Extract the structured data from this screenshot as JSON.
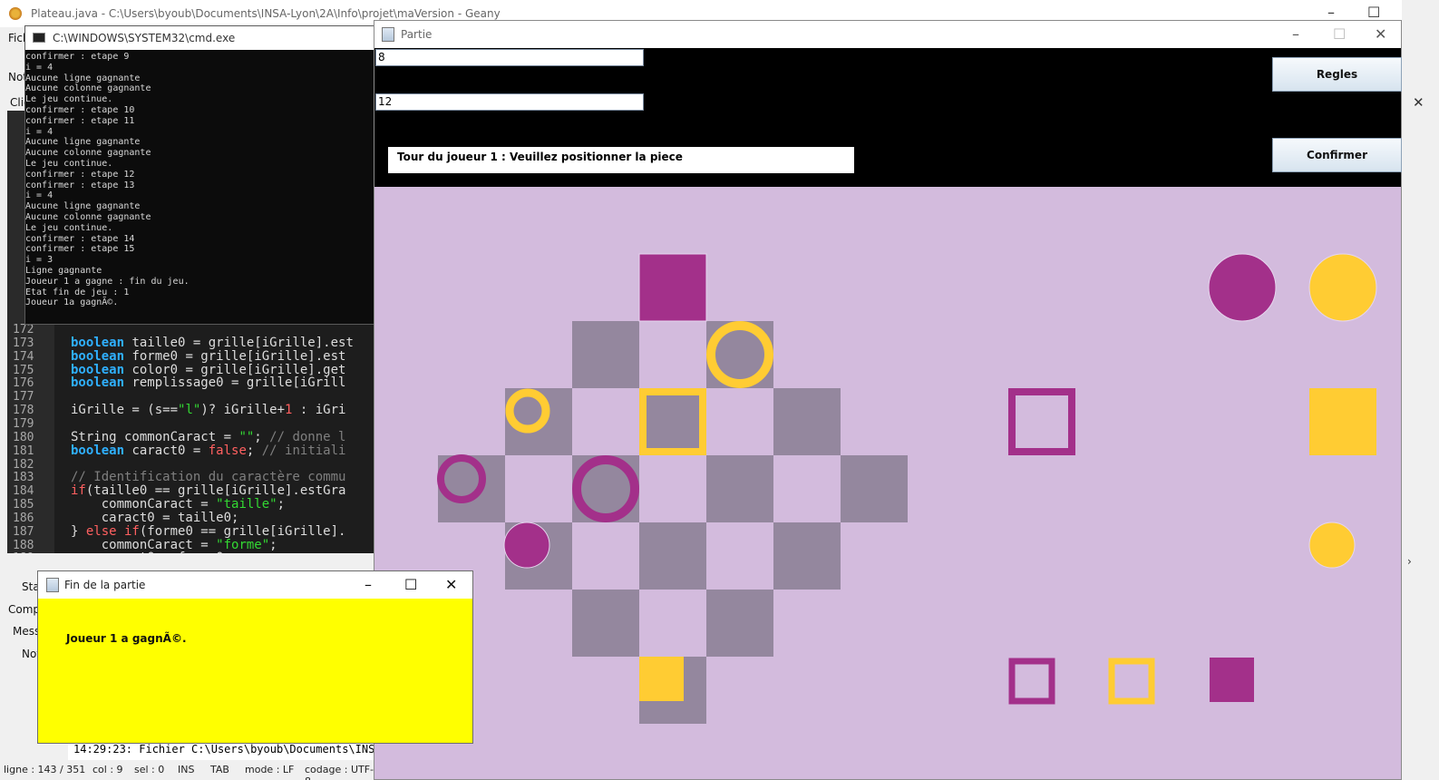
{
  "geany": {
    "title": "Plateau.java - C:\\Users\\byoub\\Documents\\INSA-Lyon\\2A\\Info\\projet\\maVersion - Geany",
    "menu_partial": "Fich",
    "toolbar_partial": "Not",
    "tab_partial": "Clic",
    "side_labels": [
      "Stat",
      "Compi",
      "Mess",
      "Not"
    ],
    "message_line": "14:29:23: Fichier C:\\Users\\byoub\\Documents\\INSA-",
    "status": {
      "line": "ligne : 143 / 351",
      "col": "col : 9",
      "sel": "sel : 0",
      "ins": "INS",
      "tab": "TAB",
      "mode": "mode : LF",
      "codage": "codage : UTF-8"
    },
    "code_lines": [
      {
        "n": "172",
        "parts": []
      },
      {
        "n": "173",
        "parts": [
          {
            "c": "kw",
            "t": "boolean"
          },
          {
            "c": "",
            "t": " taille0 = grille[iGrille].est"
          }
        ]
      },
      {
        "n": "174",
        "parts": [
          {
            "c": "kw",
            "t": "boolean"
          },
          {
            "c": "",
            "t": " forme0 = grille[iGrille].est"
          }
        ]
      },
      {
        "n": "175",
        "parts": [
          {
            "c": "kw",
            "t": "boolean"
          },
          {
            "c": "",
            "t": " color0 = grille[iGrille].get"
          }
        ]
      },
      {
        "n": "176",
        "parts": [
          {
            "c": "kw",
            "t": "boolean"
          },
          {
            "c": "",
            "t": " remplissage0 = grille[iGrill"
          }
        ]
      },
      {
        "n": "177",
        "parts": []
      },
      {
        "n": "178",
        "parts": [
          {
            "c": "",
            "t": "iGrille = (s=="
          },
          {
            "c": "str",
            "t": "\"l\""
          },
          {
            "c": "",
            "t": ")? iGrille+"
          },
          {
            "c": "num",
            "t": "1"
          },
          {
            "c": "",
            "t": " : iGri"
          }
        ]
      },
      {
        "n": "179",
        "parts": []
      },
      {
        "n": "180",
        "parts": [
          {
            "c": "",
            "t": "String commonCaract = "
          },
          {
            "c": "str",
            "t": "\"\""
          },
          {
            "c": "",
            "t": "; "
          },
          {
            "c": "cmt",
            "t": "// donne l"
          }
        ]
      },
      {
        "n": "181",
        "parts": [
          {
            "c": "kw",
            "t": "boolean"
          },
          {
            "c": "",
            "t": " caract0 = "
          },
          {
            "c": "red",
            "t": "false"
          },
          {
            "c": "",
            "t": "; "
          },
          {
            "c": "cmt",
            "t": "// initiali"
          }
        ]
      },
      {
        "n": "182",
        "parts": []
      },
      {
        "n": "183",
        "parts": [
          {
            "c": "cmt",
            "t": "// Identification du caractère commu"
          }
        ]
      },
      {
        "n": "184",
        "parts": [
          {
            "c": "red",
            "t": "if"
          },
          {
            "c": "",
            "t": "(taille0 == grille[iGrille].estGra"
          }
        ]
      },
      {
        "n": "185",
        "parts": [
          {
            "c": "",
            "t": "    commonCaract = "
          },
          {
            "c": "str",
            "t": "\"taille\""
          },
          {
            "c": "",
            "t": ";"
          }
        ]
      },
      {
        "n": "186",
        "parts": [
          {
            "c": "",
            "t": "    caract0 = taille0;"
          }
        ]
      },
      {
        "n": "187",
        "parts": [
          {
            "c": "",
            "t": "} "
          },
          {
            "c": "red",
            "t": "else if"
          },
          {
            "c": "",
            "t": "(forme0 == grille[iGrille]."
          }
        ]
      },
      {
        "n": "188",
        "parts": [
          {
            "c": "",
            "t": "    commonCaract = "
          },
          {
            "c": "str",
            "t": "\"forme\""
          },
          {
            "c": "",
            "t": ";"
          }
        ]
      },
      {
        "n": "189",
        "parts": [
          {
            "c": "",
            "t": "    caract0 = forme0;"
          }
        ]
      }
    ]
  },
  "cmd": {
    "title": "C:\\WINDOWS\\SYSTEM32\\cmd.exe",
    "lines": [
      "confirmer : etape 9",
      "i = 4",
      "Aucune ligne gagnante",
      "Aucune colonne gagnante",
      "Le jeu continue.",
      "confirmer : etape 10",
      "confirmer : etape 11",
      "i = 4",
      "Aucune ligne gagnante",
      "Aucune colonne gagnante",
      "Le jeu continue.",
      "confirmer : etape 12",
      "confirmer : etape 13",
      "i = 4",
      "Aucune ligne gagnante",
      "Aucune colonne gagnante",
      "Le jeu continue.",
      "confirmer : etape 14",
      "confirmer : etape 15",
      "i = 3",
      "Ligne gagnante",
      "Joueur 1 a gagne : fin du jeu.",
      "Etat fin de jeu : 1",
      "Joueur 1a gagnÃ©."
    ]
  },
  "partie": {
    "title": "Partie",
    "field1": "8",
    "field2": "12",
    "regles_label": "Regles",
    "confirmer_label": "Confirmer",
    "status_text": "Tour du joueur 1 : Veuillez positionner la piece",
    "colors": {
      "background": "#d3bbdd",
      "dark_cell": "#94879e",
      "purple": "#a3308a",
      "yellow": "#ffcc33"
    }
  },
  "fin": {
    "title": "Fin de la partie",
    "message": "Joueur 1 a gagnÃ©.",
    "background": "#ffff00"
  }
}
